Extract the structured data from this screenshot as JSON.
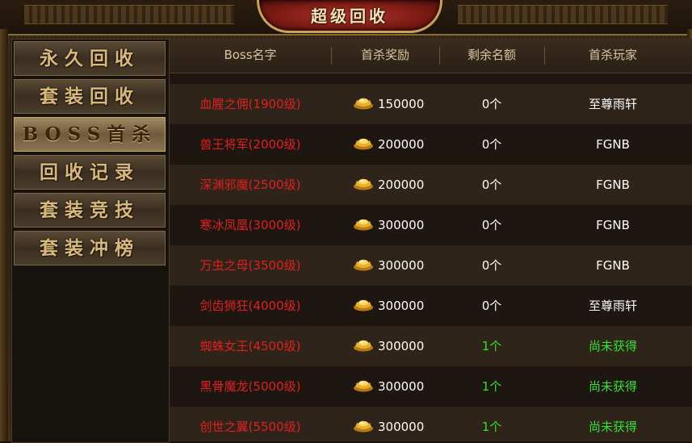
{
  "window": {
    "title": "超级回收"
  },
  "sidebar": {
    "items": [
      {
        "label": "永久回收",
        "active": false
      },
      {
        "label": "套装回收",
        "active": false
      },
      {
        "label": "BOSS首杀",
        "active": true
      },
      {
        "label": "回收记录",
        "active": false
      },
      {
        "label": "套装竞技",
        "active": false
      },
      {
        "label": "套装冲榜",
        "active": false
      }
    ]
  },
  "table": {
    "headers": {
      "boss": "Boss名字",
      "reward": "首杀奖励",
      "remain": "剩余名额",
      "player": "首杀玩家"
    },
    "rows": [
      {
        "boss": "血腥之佣(1900级)",
        "reward": "150000",
        "remain": "0个",
        "player": "至尊雨轩",
        "remain_available": false,
        "player_none": false
      },
      {
        "boss": "兽王将军(2000级)",
        "reward": "200000",
        "remain": "0个",
        "player": "FGNB",
        "remain_available": false,
        "player_none": false
      },
      {
        "boss": "深渊邪魔(2500级)",
        "reward": "200000",
        "remain": "0个",
        "player": "FGNB",
        "remain_available": false,
        "player_none": false
      },
      {
        "boss": "寒冰凤凰(3000级)",
        "reward": "300000",
        "remain": "0个",
        "player": "FGNB",
        "remain_available": false,
        "player_none": false
      },
      {
        "boss": "万虫之母(3500级)",
        "reward": "300000",
        "remain": "0个",
        "player": "FGNB",
        "remain_available": false,
        "player_none": false
      },
      {
        "boss": "剑齿狮狂(4000级)",
        "reward": "300000",
        "remain": "0个",
        "player": "至尊雨轩",
        "remain_available": false,
        "player_none": false
      },
      {
        "boss": "蜘蛛女王(4500级)",
        "reward": "300000",
        "remain": "1个",
        "player": "尚未获得",
        "remain_available": true,
        "player_none": true
      },
      {
        "boss": "黑骨魔龙(5000级)",
        "reward": "300000",
        "remain": "1个",
        "player": "尚未获得",
        "remain_available": true,
        "player_none": true
      },
      {
        "boss": "创世之翼(5500级)",
        "reward": "300000",
        "remain": "1个",
        "player": "尚未获得",
        "remain_available": true,
        "player_none": true
      }
    ]
  },
  "icons": {
    "reward": "gold-ingot-icon"
  },
  "colors": {
    "boss_name": "#e02020",
    "available": "#35e030",
    "text": "#ffffff",
    "title_plate": "#7a1a14",
    "gold_border": "#c9a35a"
  }
}
